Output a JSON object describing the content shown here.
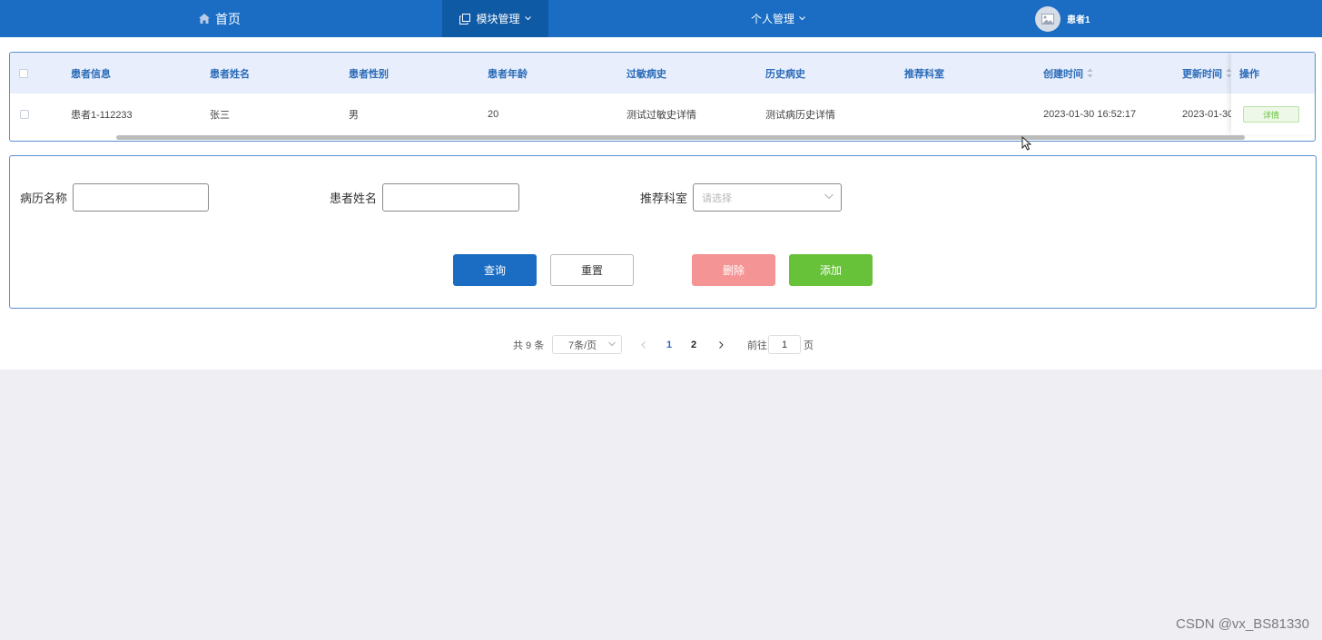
{
  "topnav": {
    "home": {
      "label": "首页",
      "icon": "home-icon"
    },
    "module": {
      "label": "模块管理",
      "icon": "copy-icon"
    },
    "personal": {
      "label": "个人管理"
    },
    "user": {
      "name": "患者1",
      "icon": "image-icon"
    }
  },
  "table": {
    "columns": [
      "患者信息",
      "患者姓名",
      "患者性别",
      "患者年龄",
      "过敏病史",
      "历史病史",
      "推荐科室",
      "创建时间",
      "更新时间",
      "操作"
    ],
    "rows": [
      {
        "info": "患者1-112233",
        "name": "张三",
        "gender": "男",
        "age": "20",
        "allergy": "测试过敏史详情",
        "history": "测试病历史详情",
        "department": "",
        "created": "2023-01-30 16:52:17",
        "updated": "2023-01-30",
        "action": "详情"
      }
    ]
  },
  "form": {
    "record_name_label": "病历名称",
    "record_name_value": "",
    "patient_name_label": "患者姓名",
    "patient_name_value": "",
    "department_label": "推荐科室",
    "department_placeholder": "请选择",
    "query_label": "查询",
    "reset_label": "重置",
    "delete_label": "删除",
    "add_label": "添加"
  },
  "pagination": {
    "total": "共 9 条",
    "page_size": "7条/页",
    "pages": [
      "1",
      "2"
    ],
    "current": "1",
    "goto_label": "前往",
    "goto_value": "1",
    "page_suffix": "页"
  },
  "watermark": "CSDN @vx_BS81330",
  "colors": {
    "nav": "#1a6dc3",
    "nav_active": "#0f5aa5",
    "delete": "#f59494",
    "add": "#67c23a"
  }
}
